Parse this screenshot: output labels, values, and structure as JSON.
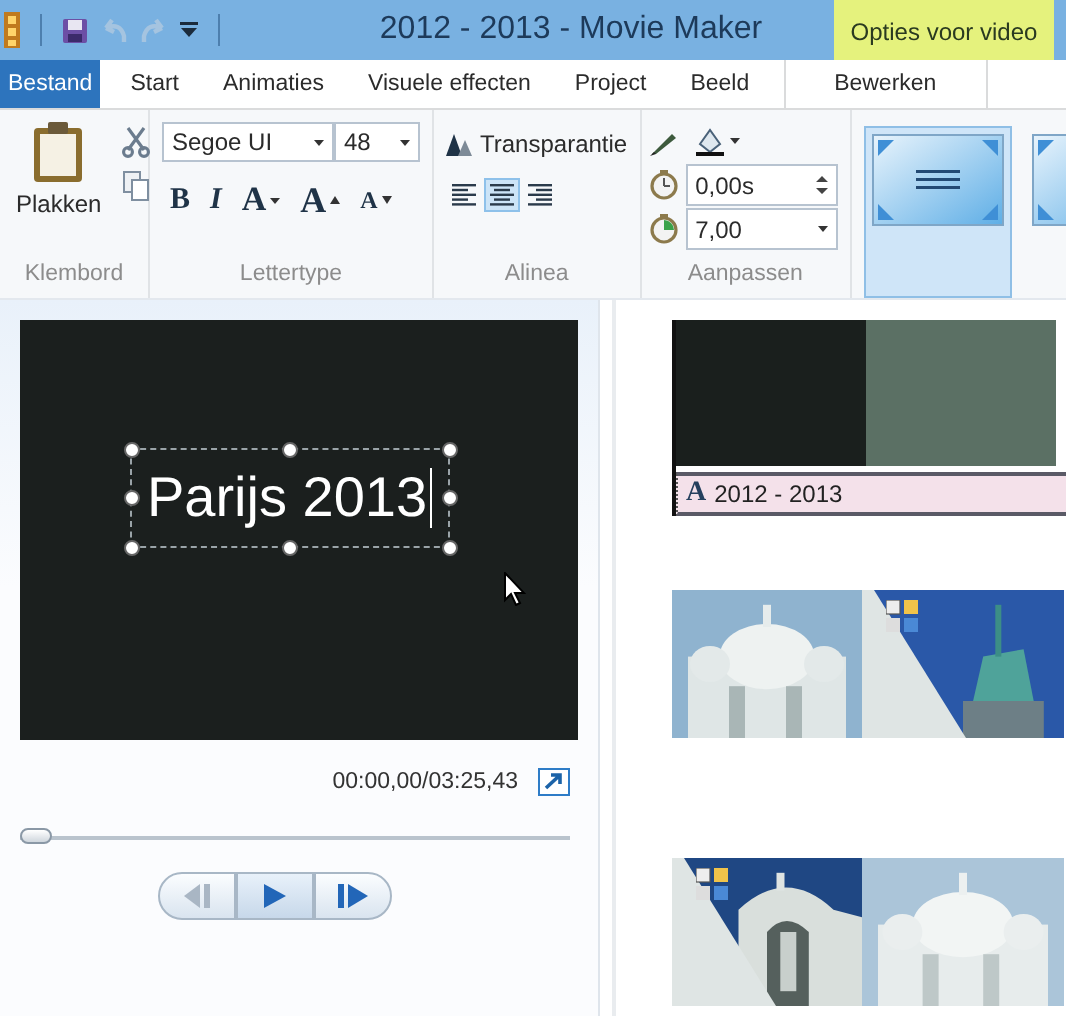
{
  "window": {
    "title": "2012 - 2013 - Movie Maker",
    "contextual_tab": "Opties voor video"
  },
  "tabs": [
    {
      "label": "Bestand",
      "kind": "file",
      "selected": false
    },
    {
      "label": "Start",
      "kind": "tab",
      "selected": false
    },
    {
      "label": "Animaties",
      "kind": "tab",
      "selected": false
    },
    {
      "label": "Visuele effecten",
      "kind": "tab",
      "selected": false
    },
    {
      "label": "Project",
      "kind": "tab",
      "selected": false
    },
    {
      "label": "Beeld",
      "kind": "tab",
      "selected": false
    },
    {
      "label": "Bewerken",
      "kind": "context",
      "selected": false
    }
  ],
  "ribbon": {
    "clipboard": {
      "paste": "Plakken",
      "label": "Klembord"
    },
    "font": {
      "family": "Segoe UI",
      "size": "48",
      "bold": "B",
      "italic": "I",
      "color_glyph": "A",
      "grow": "A",
      "shrink": "A",
      "label": "Lettertype"
    },
    "paragraph": {
      "transparency": "Transparantie",
      "align": [
        {
          "kind": "left",
          "selected": false
        },
        {
          "kind": "center",
          "selected": true
        },
        {
          "kind": "right",
          "selected": false
        }
      ],
      "label": "Alinea"
    },
    "adjust": {
      "start_time": "0,00s",
      "duration": "7,00",
      "label": "Aanpassen"
    },
    "effects": [
      {
        "selected": true
      },
      {
        "selected": false
      }
    ]
  },
  "preview": {
    "caption": "Parijs 2013",
    "time": "00:00,00/03:25,43",
    "seek": {
      "level": 0
    }
  },
  "storyboard": {
    "title_clip": {
      "frames": [
        {
          "color": "#1a1f1d"
        },
        {
          "color": "#5b7064"
        }
      ],
      "caption_icon": "A",
      "caption": "2012 - 2013"
    },
    "rows": [
      {
        "clips": [
          {
            "kind": "dome",
            "transition": false
          },
          {
            "kind": "statue",
            "transition": true
          }
        ]
      },
      {
        "clips": [
          {
            "kind": "niche",
            "transition": true
          },
          {
            "kind": "faded",
            "transition": false
          }
        ]
      }
    ]
  }
}
